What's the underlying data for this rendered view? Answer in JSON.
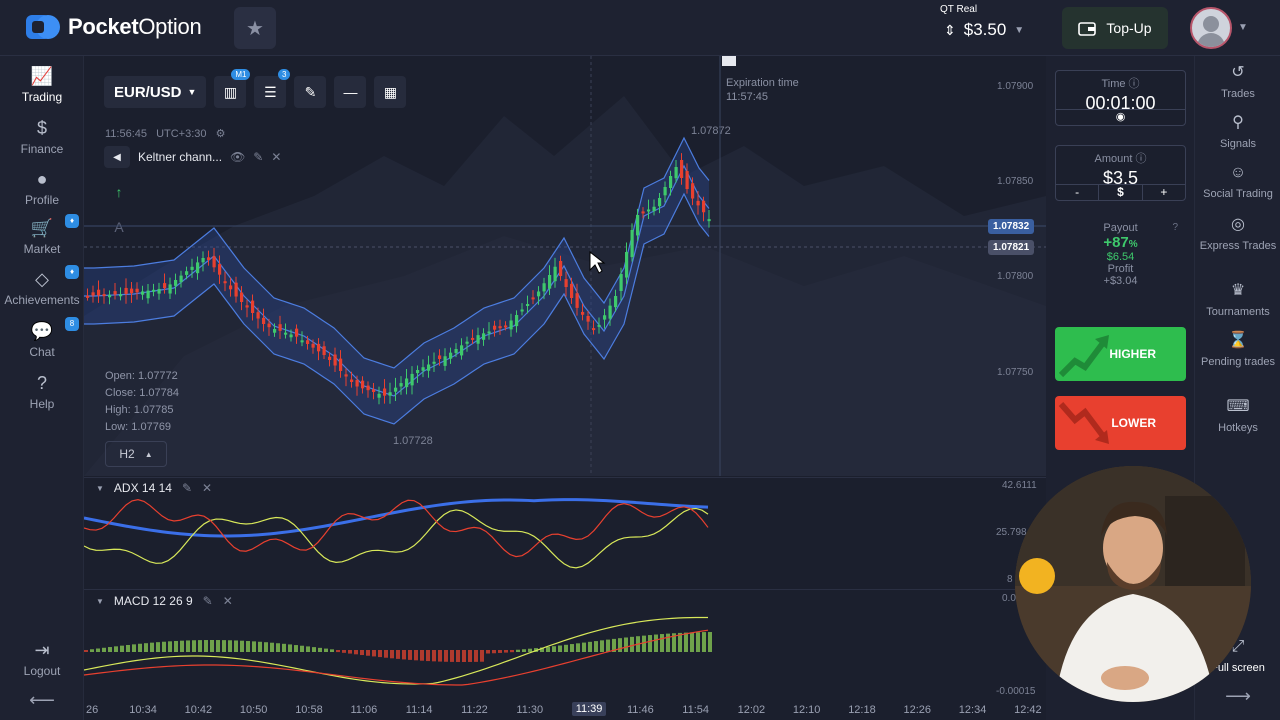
{
  "app": {
    "brand_prefix": "Pocket",
    "brand_suffix": "Option"
  },
  "header": {
    "account_label": "QT Real",
    "balance": "$3.50",
    "topup_label": "Top-Up"
  },
  "left_nav": {
    "items": [
      {
        "label": "Trading",
        "icon": "chart-line-icon",
        "active": true
      },
      {
        "label": "Finance",
        "icon": "dollar-icon"
      },
      {
        "label": "Profile",
        "icon": "user-icon"
      },
      {
        "label": "Market",
        "icon": "cart-icon",
        "badge": true
      },
      {
        "label": "Achievements",
        "icon": "diamond-icon",
        "badge": true
      },
      {
        "label": "Chat",
        "icon": "chat-icon",
        "badge": "8"
      },
      {
        "label": "Help",
        "icon": "help-icon"
      }
    ],
    "logout_label": "Logout"
  },
  "toolbar": {
    "pair": "EUR/USD",
    "chart_type_badge": "M1",
    "indicators_badge": "3"
  },
  "chart": {
    "clock": "11:56:45",
    "timezone": "UTC+3:30",
    "indicator_name": "Keltner chann...",
    "expiration_label": "Expiration time",
    "expiration_time": "11:57:45",
    "high_marker": "1.07872",
    "low_marker": "1.07728",
    "ohlc": {
      "open": "Open: 1.07772",
      "close": "Close: 1.07784",
      "high": "High: 1.07785",
      "low": "Low: 1.07769"
    },
    "timeframe": "H2",
    "price_ticks": [
      "1.07900",
      "1.07850",
      "1.07800",
      "1.07750"
    ],
    "current_price": "1.07832",
    "secondary_price": "1.07821",
    "adx_title": "ADX 14 14",
    "adx_ticks": [
      "42.6111",
      "25.798",
      "8"
    ],
    "macd_title": "MACD 12 26 9",
    "macd_ticks": [
      "0.0",
      "-0.00015"
    ],
    "time_labels": [
      "26",
      "10:34",
      "10:42",
      "10:50",
      "10:58",
      "11:06",
      "11:14",
      "11:22",
      "11:30",
      "11:39",
      "11:46",
      "11:54",
      "12:02",
      "12:10",
      "12:18",
      "12:26",
      "12:34",
      "12:42"
    ],
    "current_time_label": "11:39"
  },
  "trade_panel": {
    "time_label": "Time",
    "time_value": "00:01:00",
    "amount_label": "Amount",
    "amount_value": "$3.5",
    "minus": "-",
    "currency": "$",
    "plus": "+",
    "payout_label": "Payout",
    "payout_percent": "+87",
    "payout_percent_sign": "%",
    "payout_amount": "$6.54",
    "profit_label": "Profit",
    "profit_value": "+$3.04",
    "higher_label": "HIGHER",
    "lower_label": "LOWER",
    "higher_color": "#2ebd4e",
    "lower_color": "#e8402f"
  },
  "right_nav": {
    "items": [
      {
        "label": "Trades",
        "icon": "history-icon"
      },
      {
        "label": "Signals",
        "icon": "signal-icon"
      },
      {
        "label": "Social Trading",
        "icon": "users-icon"
      },
      {
        "label": "Express Trades",
        "icon": "target-icon"
      },
      {
        "label": "Tournaments",
        "icon": "trophy-icon"
      },
      {
        "label": "Pending trades",
        "icon": "hourglass-icon"
      },
      {
        "label": "Hotkeys",
        "icon": "keyboard-icon"
      }
    ],
    "fullscreen_label": "Full screen"
  }
}
